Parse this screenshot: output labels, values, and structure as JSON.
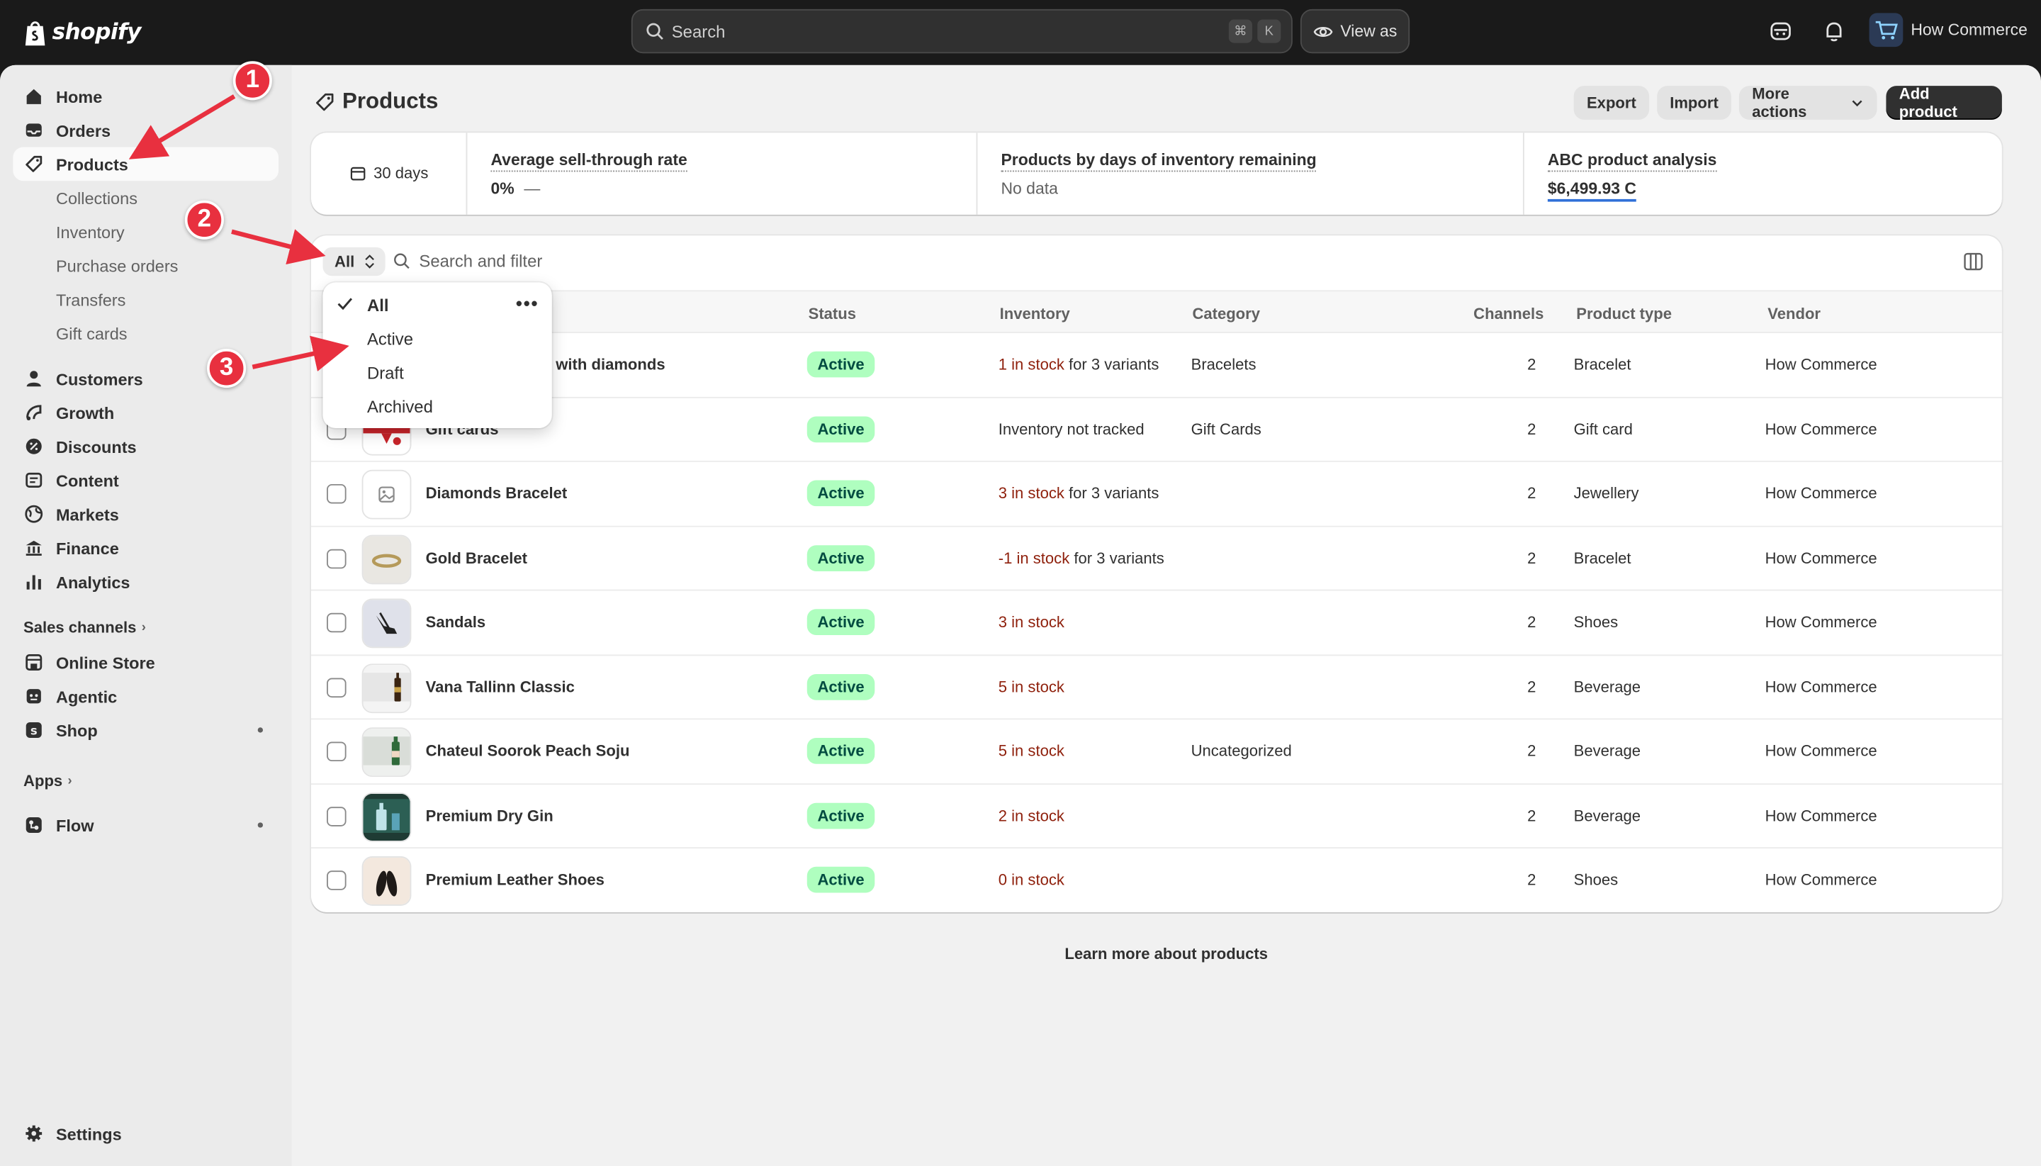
{
  "topbar": {
    "brand": "shopify",
    "search_placeholder": "Search",
    "search_key1": "⌘",
    "search_key2": "K",
    "view_as": "View as",
    "store_name": "How Commerce"
  },
  "sidebar": {
    "items": [
      {
        "label": "Home",
        "icon": "home-icon"
      },
      {
        "label": "Orders",
        "icon": "orders-inbox-icon"
      },
      {
        "label": "Products",
        "icon": "tag-icon"
      },
      {
        "label": "Collections"
      },
      {
        "label": "Inventory"
      },
      {
        "label": "Purchase orders"
      },
      {
        "label": "Transfers"
      },
      {
        "label": "Gift cards"
      },
      {
        "label": "Customers",
        "icon": "person-icon"
      },
      {
        "label": "Growth",
        "icon": "growth-icon"
      },
      {
        "label": "Discounts",
        "icon": "discount-icon"
      },
      {
        "label": "Content",
        "icon": "content-icon"
      },
      {
        "label": "Markets",
        "icon": "globe-icon"
      },
      {
        "label": "Finance",
        "icon": "bank-icon"
      },
      {
        "label": "Analytics",
        "icon": "bar-chart-icon"
      }
    ],
    "sales_channels_label": "Sales channels",
    "channels": [
      {
        "label": "Online Store",
        "icon": "store-icon"
      },
      {
        "label": "Agentic",
        "icon": "agentic-icon"
      },
      {
        "label": "Shop",
        "icon": "shop-icon"
      }
    ],
    "apps_label": "Apps",
    "apps": [
      {
        "label": "Flow",
        "icon": "flow-icon"
      }
    ],
    "settings": "Settings"
  },
  "page": {
    "title": "Products",
    "export": "Export",
    "import": "Import",
    "more_actions": "More actions",
    "add_product": "Add product"
  },
  "analytics": {
    "date_range": "30 days",
    "sell_through_title": "Average sell-through rate",
    "sell_through_value": "0%",
    "sell_through_dash": "—",
    "days_inventory_title": "Products by days of inventory remaining",
    "days_inventory_value": "No data",
    "abc_title": "ABC product analysis",
    "abc_value": "$6,499.93 C"
  },
  "filter": {
    "tab": "All",
    "search_placeholder": "Search and filter"
  },
  "table": {
    "headers": {
      "status": "Status",
      "inventory": "Inventory",
      "category": "Category",
      "channels": "Channels",
      "product_type": "Product type",
      "vendor": "Vendor"
    },
    "rows": [
      {
        "name": "with diamonds",
        "status": "Active",
        "inv_red": "1 in stock",
        "inv_rest": " for 3 variants",
        "category": "Bracelets",
        "channels": "2",
        "type": "Bracelet",
        "vendor": "How Commerce"
      },
      {
        "name": "Gift cards",
        "status": "Active",
        "inv_plain": "Inventory not tracked",
        "category": "Gift Cards",
        "channels": "2",
        "type": "Gift card",
        "vendor": "How Commerce"
      },
      {
        "name": "Diamonds Bracelet",
        "status": "Active",
        "inv_red": "3 in stock",
        "inv_rest": " for 3 variants",
        "category": "",
        "channels": "2",
        "type": "Jewellery",
        "vendor": "How Commerce"
      },
      {
        "name": "Gold Bracelet",
        "status": "Active",
        "inv_red": "-1 in stock",
        "inv_rest": " for 3 variants",
        "category": "",
        "channels": "2",
        "type": "Bracelet",
        "vendor": "How Commerce"
      },
      {
        "name": "Sandals",
        "status": "Active",
        "inv_red": "3 in stock",
        "inv_rest": "",
        "category": "",
        "channels": "2",
        "type": "Shoes",
        "vendor": "How Commerce"
      },
      {
        "name": "Vana Tallinn Classic",
        "status": "Active",
        "inv_red": "5 in stock",
        "inv_rest": "",
        "category": "",
        "channels": "2",
        "type": "Beverage",
        "vendor": "How Commerce"
      },
      {
        "name": "Chateul Soorok Peach Soju",
        "status": "Active",
        "inv_red": "5 in stock",
        "inv_rest": "",
        "category": "Uncategorized",
        "channels": "2",
        "type": "Beverage",
        "vendor": "How Commerce"
      },
      {
        "name": "Premium Dry Gin",
        "status": "Active",
        "inv_red": "2 in stock",
        "inv_rest": "",
        "category": "",
        "channels": "2",
        "type": "Beverage",
        "vendor": "How Commerce"
      },
      {
        "name": "Premium Leather Shoes",
        "status": "Active",
        "inv_red": "0 in stock",
        "inv_rest": "",
        "category": "",
        "channels": "2",
        "type": "Shoes",
        "vendor": "How Commerce"
      }
    ],
    "learn_more": "Learn more about products"
  },
  "dropdown": {
    "options": [
      "All",
      "Active",
      "Draft",
      "Archived"
    ],
    "selected": "All"
  },
  "annotations": [
    "1",
    "2",
    "3"
  ],
  "colors": {
    "topbar": "#1a1a1a",
    "active_badge_bg": "#affebf",
    "active_badge_text": "#014b40",
    "stock_red": "#8e1f0b",
    "annotation_red": "#e8303f",
    "primary_button": "#303030"
  }
}
